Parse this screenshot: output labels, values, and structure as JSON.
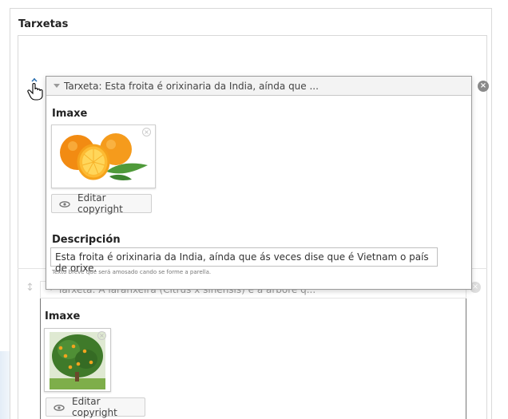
{
  "section": {
    "title": "Tarxetas"
  },
  "dragged_card": {
    "title": "Tarxeta: Esta froita é orixinaria da India, aínda que ...",
    "image_label": "Imaxe",
    "image_alt": "Laranxas (oranges)",
    "copyright_button": "Editar copyright",
    "description_label": "Descripción",
    "description_value": "Esta froita é orixinaria da India, aínda que ás veces dise que é Vietnam o país de orixe.",
    "help_text": "Texto breve que será amosado cando se forme a parella."
  },
  "second_card": {
    "title": "Tarxeta: A laranxeira (Citrus x sinensis) é a árbore q...",
    "image_label": "Imaxe",
    "image_alt": "Laranxeira (orange tree)",
    "copyright_button": "Editar copyright"
  },
  "icons": {
    "close": "close-icon",
    "collapse": "triangle-down-icon",
    "copyright": "copyright-icon",
    "drag": "drag-handle-icon",
    "cursor": "hand-pointer-icon"
  },
  "colors": {
    "border": "#d9d9d9",
    "header_bg": "#f3f3f3",
    "close_bg": "#8a8a8a"
  }
}
